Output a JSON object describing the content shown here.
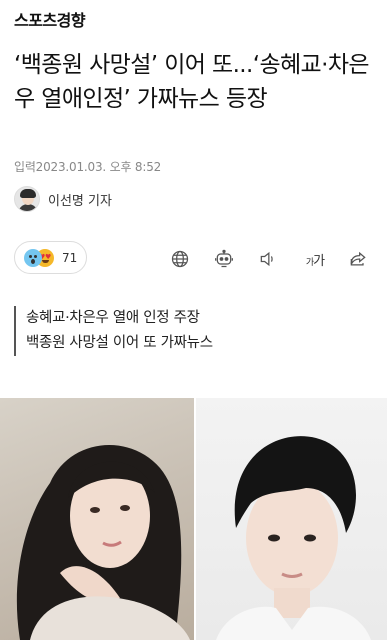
{
  "masthead": {
    "logo": "스포츠경향"
  },
  "article": {
    "headline": "‘백종원 사망설’ 이어 또...‘송혜교·차은우 열애인정’ 가짜뉴스 등장",
    "published": "입력2023.01.03. 오후 8:52",
    "reporter": "이선명 기자",
    "reaction_count": "71",
    "summary": [
      "송혜교·차은우 열애 인정 주장",
      "백종원 사망설 이어 또 가짜뉴스"
    ]
  },
  "toolbar": {
    "items": [
      "globe-icon",
      "robot-icon",
      "speaker-icon",
      "font-size-icon",
      "share-icon"
    ],
    "font_size_small": "가",
    "font_size_large": "가"
  },
  "colors": {
    "text": "#111111",
    "meta": "#888888",
    "icon": "#555555",
    "border": "#dddddd"
  }
}
